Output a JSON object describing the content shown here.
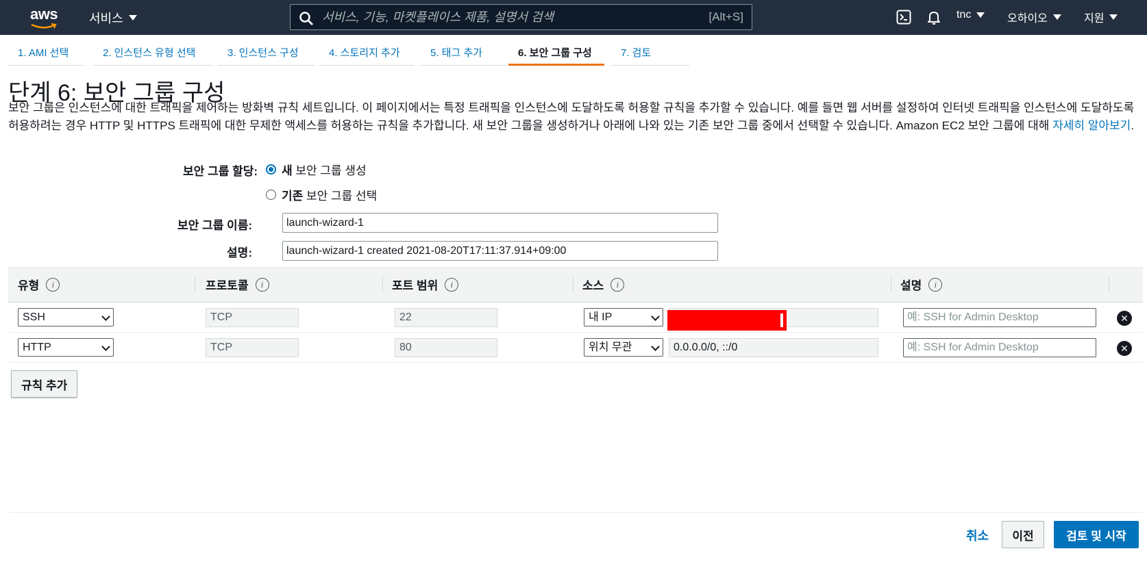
{
  "topnav": {
    "logo_text": "aws",
    "services_label": "서비스",
    "search_placeholder": "서비스, 기능, 마켓플레이스 제품, 설명서 검색",
    "search_shortcut": "[Alt+S]",
    "account_label": "tnc",
    "region_label": "오하이오",
    "support_label": "지원"
  },
  "wizard_tabs": [
    {
      "label": "1. AMI 선택",
      "active": false
    },
    {
      "label": "2. 인스턴스 유형 선택",
      "active": false
    },
    {
      "label": "3. 인스턴스 구성",
      "active": false
    },
    {
      "label": "4. 스토리지 추가",
      "active": false
    },
    {
      "label": "5. 태그 추가",
      "active": false
    },
    {
      "label": "6. 보안 그룹 구성",
      "active": true
    },
    {
      "label": "7. 검토",
      "active": false
    }
  ],
  "page": {
    "title": "단계 6: 보안 그룹 구성",
    "description": "보안 그룹은 인스턴스에 대한 트래픽을 제어하는 방화벽 규칙 세트입니다. 이 페이지에서는 특정 트래픽을 인스턴스에 도달하도록 허용할 규칙을 추가할 수 있습니다. 예를 들면 웹 서버를 설정하여 인터넷 트래픽을 인스턴스에 도달하도록 허용하려는 경우 HTTP 및 HTTPS 트래픽에 대한 무제한 액세스를 허용하는 규칙을 추가합니다. 새 보안 그룹을 생성하거나 아래에 나와 있는 기존 보안 그룹 중에서 선택할 수 있습니다. Amazon EC2 보안 그룹에 대해 ",
    "learn_more_link": "자세히 알아보기",
    "desc_end": "."
  },
  "form": {
    "assign_label": "보안 그룹 할당:",
    "option_new_bold": "새",
    "option_new_rest": "보안 그룹 생성",
    "option_existing_bold": "기존",
    "option_existing_rest": "보안 그룹 선택",
    "name_label": "보안 그룹 이름:",
    "name_value": "launch-wizard-1",
    "desc_label": "설명:",
    "desc_value": "launch-wizard-1 created 2021-08-20T17:11:37.914+09:00"
  },
  "rules_table": {
    "headers": [
      "유형",
      "프로토콜",
      "포트 범위",
      "소스",
      "설명"
    ],
    "info_glyph": "i",
    "rows": [
      {
        "type": "SSH",
        "protocol": "TCP",
        "port": "22",
        "source_type": "내 IP",
        "source_value": "",
        "description_placeholder": "예: SSH for Admin Desktop"
      },
      {
        "type": "HTTP",
        "protocol": "TCP",
        "port": "80",
        "source_type": "위치 무관",
        "source_value": "0.0.0.0/0, ::/0",
        "description_placeholder": "예: SSH for Admin Desktop"
      }
    ],
    "delete_glyph": "✕"
  },
  "add_rule_label": "규칙 추가",
  "footer": {
    "cancel_label": "취소",
    "previous_label": "이전",
    "launch_label": "검토 및 시작"
  }
}
